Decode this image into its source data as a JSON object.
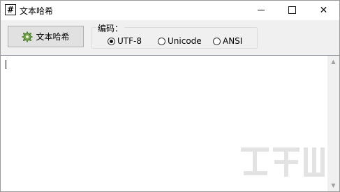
{
  "window": {
    "title": "文本哈希",
    "app_icon_glyph": "#"
  },
  "toolbar": {
    "hash_button_label": "文本哈希",
    "encoding_label": "编码：",
    "encodings": [
      {
        "label": "UTF-8",
        "checked": true
      },
      {
        "label": "Unicode",
        "checked": false
      },
      {
        "label": "ANSI",
        "checked": false
      }
    ]
  },
  "editor": {
    "content": ""
  },
  "icons": {
    "app": "hash-icon",
    "hash_button": "gear-icon",
    "minimize": "minimize-icon",
    "maximize": "maximize-icon",
    "close": "close-icon"
  },
  "colors": {
    "window_bg": "#f0f0f0",
    "button_bg": "#e1e1e1",
    "text_area_bg": "#ffffff",
    "gear_green": "#5c8a3a"
  }
}
